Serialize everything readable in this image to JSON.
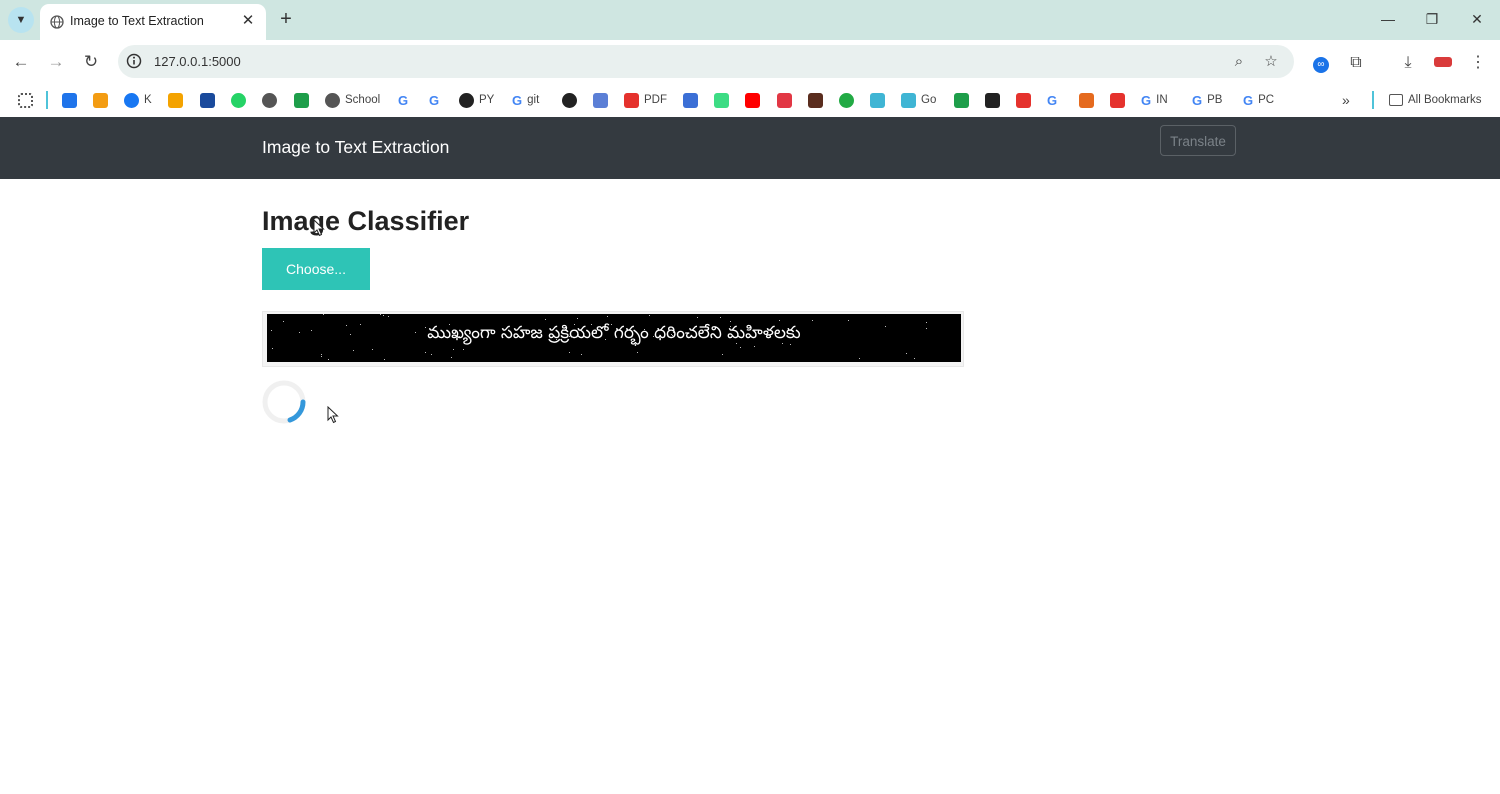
{
  "browser": {
    "tab_title": "Image to Text Extraction",
    "url": "127.0.0.1:5000",
    "bookmarks": [
      {
        "label": "",
        "icon": "apps-grid-icon"
      },
      {
        "label": "",
        "icon": "flipkart-icon",
        "color": "#1f74ea"
      },
      {
        "label": "",
        "icon": "orange-app-icon",
        "color": "#f39c12"
      },
      {
        "label": "K",
        "icon": "facebook-icon",
        "color": "#1877f2"
      },
      {
        "label": "",
        "icon": "analytics-icon",
        "color": "#f4a300"
      },
      {
        "label": "",
        "icon": "ieee-icon",
        "color": "#1a4a9c"
      },
      {
        "label": "",
        "icon": "whatsapp-icon",
        "color": "#25d366"
      },
      {
        "label": "",
        "icon": "globe-icon",
        "color": "#555555"
      },
      {
        "label": "",
        "icon": "plus-app-icon",
        "color": "#1e9e4a"
      },
      {
        "label": "School",
        "icon": "globe-icon",
        "color": "#555555"
      },
      {
        "label": "",
        "icon": "google-icon",
        "color": "#4285f4"
      },
      {
        "label": "",
        "icon": "google-icon",
        "color": "#4285f4"
      },
      {
        "label": "PY",
        "icon": "github-icon",
        "color": "#222222"
      },
      {
        "label": "git",
        "icon": "google-icon",
        "color": "#4285f4"
      },
      {
        "label": "",
        "icon": "openai-icon",
        "color": "#222222"
      },
      {
        "label": "",
        "icon": "bird-icon",
        "color": "#5b7fd6"
      },
      {
        "label": "PDF",
        "icon": "pdf-icon",
        "color": "#e5322d"
      },
      {
        "label": "",
        "icon": "blue-app-icon",
        "color": "#3b6fd6"
      },
      {
        "label": "",
        "icon": "android-icon",
        "color": "#3ddc84"
      },
      {
        "label": "",
        "icon": "youtube-icon",
        "color": "#ff0000"
      },
      {
        "label": "",
        "icon": "zomato-icon",
        "color": "#e23744"
      },
      {
        "label": "",
        "icon": "dark-app-icon",
        "color": "#5a2d1e"
      },
      {
        "label": "",
        "icon": "ring-icon",
        "color": "#22aa44"
      },
      {
        "label": "",
        "icon": "heart-icon",
        "color": "#3fb5d4"
      },
      {
        "label": "Go",
        "icon": "heart-icon",
        "color": "#3fb5d4"
      },
      {
        "label": "",
        "icon": "green-app-icon",
        "color": "#1e9e4a"
      },
      {
        "label": "",
        "icon": "codechef-icon",
        "color": "#222222"
      },
      {
        "label": "",
        "icon": "red-app-icon",
        "color": "#e5322d"
      },
      {
        "label": "",
        "icon": "google-icon",
        "color": "#4285f4"
      },
      {
        "label": "",
        "icon": "matlab-icon",
        "color": "#e56a1e"
      },
      {
        "label": "",
        "icon": "sun-app-icon",
        "color": "#e5322d"
      },
      {
        "label": "IN",
        "icon": "google-icon",
        "color": "#4285f4"
      },
      {
        "label": "PB",
        "icon": "google-icon",
        "color": "#4285f4"
      },
      {
        "label": "PC",
        "icon": "google-icon",
        "color": "#4285f4"
      }
    ],
    "all_bookmarks_label": "All Bookmarks"
  },
  "page": {
    "brand": "Image to Text Extraction",
    "translate_label": "Translate",
    "heading": "Image Classifier",
    "choose_label": "Choose...",
    "image_text": "ముఖ్యంగా సహజ ప్రక్రియలో గర్భం ధరించలేని మహిళలకు"
  },
  "colors": {
    "navbar": "#343a40",
    "choose_button": "#2ec4b6",
    "spinner": "#3498db"
  }
}
